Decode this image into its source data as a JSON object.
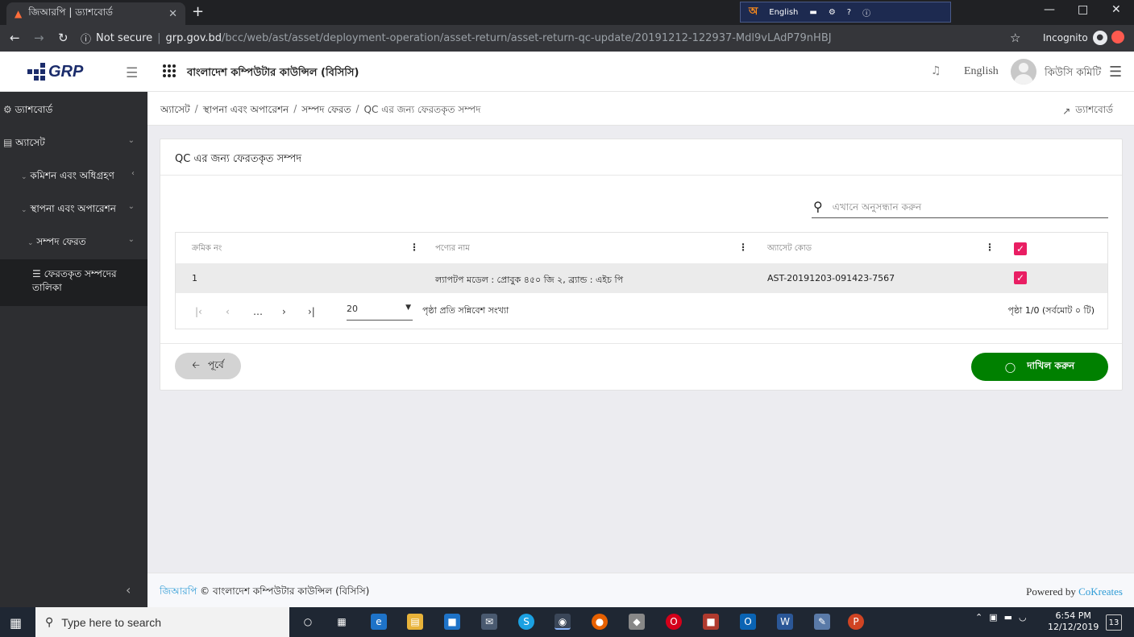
{
  "browser": {
    "tab_title": "জিআরপি | ড্যাশবোর্ড",
    "new_tab": "+",
    "url_secure_label": "Not secure",
    "url_host": "grp.gov.bd",
    "url_path": "/bcc/web/ast/asset/deployment-operation/asset-return/asset-return-qc-update/20191212-122937-Mdl9vLAdP79nHBJ",
    "incognito_label": "Incognito",
    "lang_bar_label": "English"
  },
  "header": {
    "logo_text": "GRP",
    "org_name": "বাংলাদেশ কম্পিউটার কাউন্সিল (বিসিসি)",
    "language_link": "English",
    "user_name": "কিউসি কমিটি"
  },
  "sidebar": {
    "items": [
      {
        "label": "ড্যাশবোর্ড",
        "icon": "dashboard-icon"
      },
      {
        "label": "অ্যাসেট",
        "icon": "document-icon"
      },
      {
        "label": "কমিশন এবং অধিগ্রহণ"
      },
      {
        "label": "স্থাপনা এবং অপারেশন"
      },
      {
        "label": "সম্পদ ফেরত"
      },
      {
        "label": "ফেরতকৃত সম্পদের তালিকা",
        "icon": "list-icon"
      }
    ]
  },
  "breadcrumb": {
    "items": [
      "অ্যাসেট",
      "স্থাপনা এবং অপারেশন",
      "সম্পদ ফেরত"
    ],
    "current": "QC এর জন্য ফেরতকৃত সম্পদ",
    "dashboard_link": "ড্যাশবোর্ড"
  },
  "card": {
    "title": "QC এর জন্য ফেরতকৃত সম্পদ",
    "search_placeholder": "এখানে অনুসন্ধান করুন"
  },
  "table": {
    "columns": [
      "ক্রমিক নং",
      "পণ্যের নাম",
      "অ্যাসেট কোড"
    ],
    "rows": [
      {
        "serial": "1",
        "product": "ল্যাপটপ মডেল : প্রোবুক ৪৫০ জি ২, ব্র্যান্ড : এইচ পি",
        "code": "AST-20191203-091423-7567",
        "checked": true
      }
    ],
    "header_checked": true
  },
  "pagination": {
    "page_size": "20",
    "page_size_label": "পৃষ্ঠা প্রতি সন্নিবেশ সংখ্যা",
    "info": "পৃষ্ঠা 1/0 (সর্বমোট ০ টি)"
  },
  "buttons": {
    "back": "পূর্বে",
    "submit": "দাখিল করুন"
  },
  "footer": {
    "brand": "জিআরপি",
    "copyright": " © বাংলাদেশ কম্পিউটার কাউন্সিল (বিসিসি)",
    "powered_by": "Powered by ",
    "powered_company": "CoKreates"
  },
  "taskbar": {
    "search_placeholder": "Type here to search",
    "time": "6:54 PM",
    "date": "12/12/2019",
    "notifications": "13"
  },
  "colors": {
    "accent_pink": "#e91e63",
    "submit_green": "#008000",
    "sidebar_bg": "#2d2e31",
    "link_blue": "#2e9bd6"
  }
}
